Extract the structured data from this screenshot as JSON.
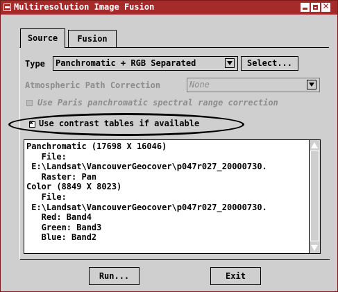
{
  "window": {
    "title": "Multiresolution Image Fusion",
    "title_close_glyph": "✕",
    "colors": {
      "titlebar": "#a52a2a",
      "background": "#cfcfcf"
    }
  },
  "tabs": [
    {
      "label": "Source",
      "selected": true
    },
    {
      "label": "Fusion",
      "selected": false
    }
  ],
  "source": {
    "type_label": "Type",
    "type_value": "Panchromatic + RGB Separated",
    "select_button": "Select...",
    "atmospheric_label": "Atmospheric Path Correction",
    "atmospheric_value": "None",
    "paris_checkbox": {
      "label": "Use Paris panchromatic spectral range correction",
      "checked": false,
      "enabled": false
    },
    "contrast_checkbox": {
      "label": "Use contrast tables if available",
      "checked": true,
      "mark": "✖",
      "enabled": true
    },
    "info_lines": [
      "Panchromatic (17698 X 16046)",
      "   File:",
      " E:\\Landsat\\VancouverGeocover\\p047r027_20000730.",
      "   Raster: Pan",
      "Color (8849 X 8023)",
      "   File:",
      " E:\\Landsat\\VancouverGeocover\\p047r027_20000730.",
      "   Red: Band4",
      "   Green: Band3",
      "   Blue: Band2"
    ]
  },
  "footer": {
    "run_button": "Run...",
    "exit_button": "Exit"
  }
}
